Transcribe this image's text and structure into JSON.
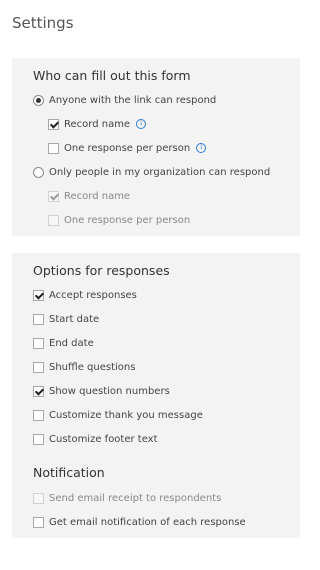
{
  "page": {
    "title": "Settings"
  },
  "who": {
    "title": "Who can fill out this form",
    "anyone_label": "Anyone with the link can respond",
    "anyone_record_name": "Record name",
    "anyone_one_response": "One response per person",
    "org_label": "Only people in my organization can respond",
    "org_record_name": "Record name",
    "org_one_response": "One response per person"
  },
  "options": {
    "title": "Options for responses",
    "accept_responses": "Accept responses",
    "start_date": "Start date",
    "end_date": "End date",
    "shuffle_questions": "Shuffle questions",
    "show_question_numbers": "Show question numbers",
    "customize_thank_you": "Customize thank you message",
    "customize_footer": "Customize footer text"
  },
  "notification": {
    "title": "Notification",
    "send_receipt": "Send email receipt to respondents",
    "get_notification": "Get email notification of each response"
  },
  "icons": {
    "info": "info-icon",
    "accent_color": "#2f7fd6"
  }
}
